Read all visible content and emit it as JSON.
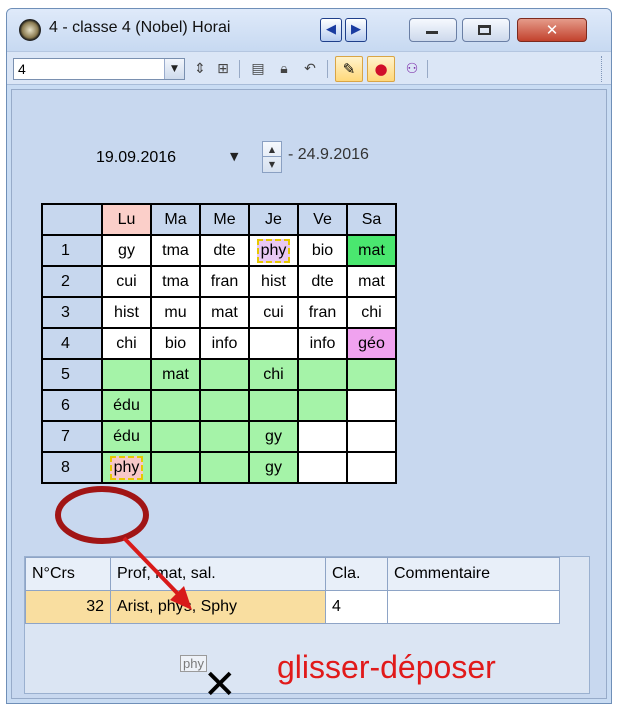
{
  "window": {
    "title": "4 - classe 4 (Nobel)  Horai",
    "nav_prev": "◀",
    "nav_next": "▶",
    "close_glyph": "✕"
  },
  "toolbar": {
    "combo_value": "4",
    "icons": [
      "sort-icon",
      "print-preview-icon",
      "export-icon",
      "lock-icon",
      "undo-icon",
      "edit-mode-icon",
      "pin-icon",
      "users-icon"
    ]
  },
  "date_bar": {
    "start_date": "19.09.2016",
    "end_date": "- 24.9.2016"
  },
  "timetable": {
    "days": [
      "Lu",
      "Ma",
      "Me",
      "Je",
      "Ve",
      "Sa"
    ],
    "periods": [
      "1",
      "2",
      "3",
      "4",
      "5",
      "6",
      "7",
      "8"
    ],
    "rows": [
      [
        "gy",
        "tma",
        "dte",
        "phy",
        "bio",
        "mat"
      ],
      [
        "cui",
        "tma",
        "fran",
        "hist",
        "dte",
        "mat"
      ],
      [
        "hist",
        "mu",
        "mat",
        "cui",
        "fran",
        "chi"
      ],
      [
        "chi",
        "bio",
        "info",
        "",
        "info",
        "géo"
      ],
      [
        "",
        "mat",
        "",
        "chi",
        "",
        ""
      ],
      [
        "édu",
        "",
        "",
        "",
        "",
        ""
      ],
      [
        "édu",
        "",
        "",
        "gy",
        "",
        ""
      ],
      [
        "phy",
        "",
        "",
        "gy",
        "",
        ""
      ]
    ]
  },
  "course_table": {
    "headers": [
      "N°Crs",
      "Prof, mat, sal.",
      "Cla.",
      "Commentaire"
    ],
    "rows": [
      {
        "num": "32",
        "info": "Arist, phys, Sphy",
        "cla": "4",
        "comment": ""
      }
    ]
  },
  "annotation": {
    "drag_tag": "phy",
    "label": "glisser-déposer",
    "color": "#e11a1a"
  }
}
